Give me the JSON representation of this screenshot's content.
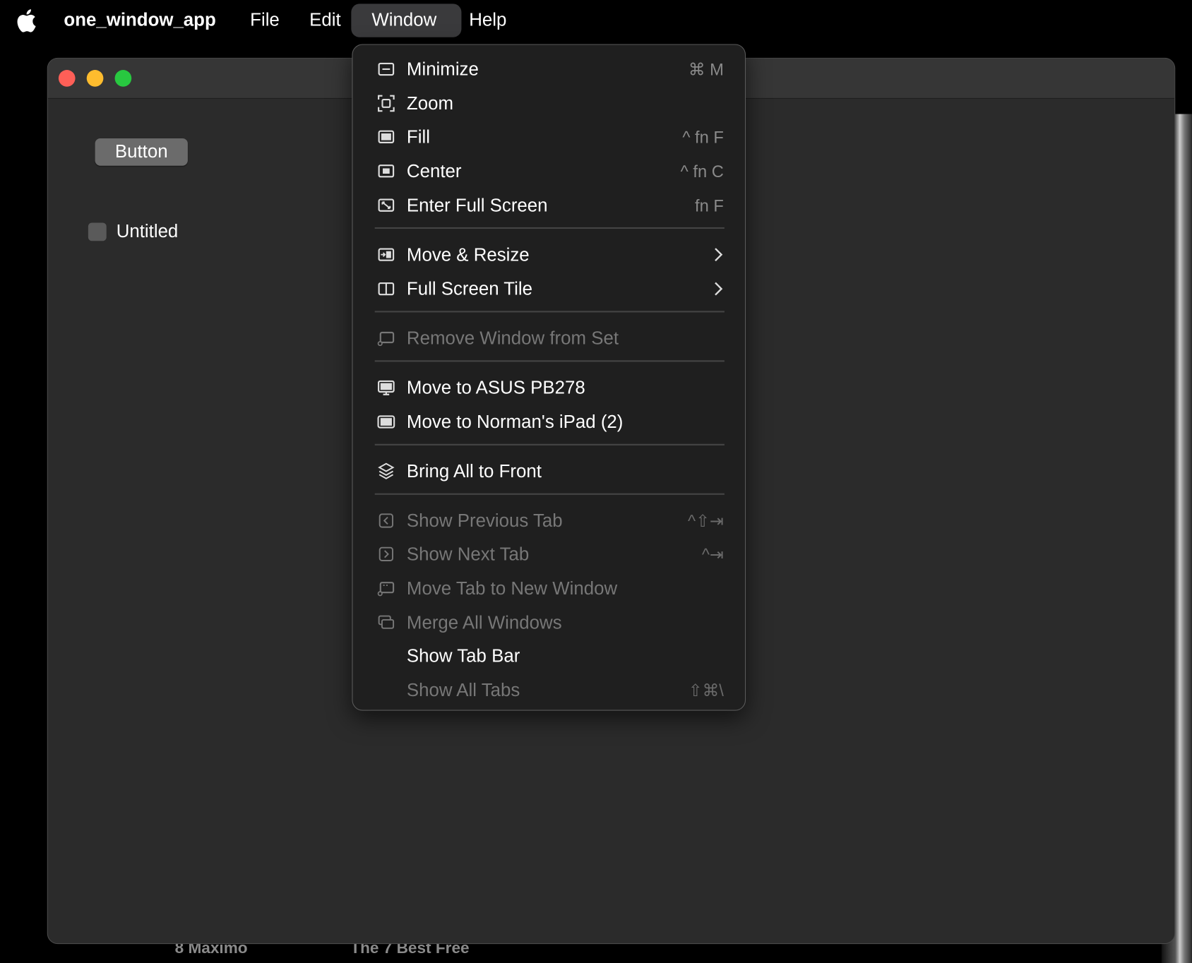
{
  "menubar": {
    "app_name": "one_window_app",
    "file": "File",
    "edit": "Edit",
    "window": "Window",
    "help": "Help"
  },
  "window_content": {
    "button_label": "Button",
    "checkbox_label": "Untitled"
  },
  "desktop": {
    "text_1": "8 Maximo",
    "text_2": "The 7 Best Free"
  },
  "window_menu": {
    "minimize": {
      "label": "Minimize",
      "shortcut": "⌘ M"
    },
    "zoom": {
      "label": "Zoom"
    },
    "fill": {
      "label": "Fill",
      "shortcut": "^ fn F"
    },
    "center": {
      "label": "Center",
      "shortcut": "^ fn C"
    },
    "enter_full_screen": {
      "label": "Enter Full Screen",
      "shortcut": "fn F"
    },
    "move_resize": {
      "label": "Move & Resize"
    },
    "full_screen_tile": {
      "label": "Full Screen Tile"
    },
    "remove_window_from_set": {
      "label": "Remove Window from Set"
    },
    "move_to_asus": {
      "label": "Move to ASUS PB278"
    },
    "move_to_ipad": {
      "label": "Move to Norman's iPad (2)"
    },
    "bring_all_to_front": {
      "label": "Bring All to Front"
    },
    "show_previous_tab": {
      "label": "Show Previous Tab",
      "shortcut": "^⇧⇥"
    },
    "show_next_tab": {
      "label": "Show Next Tab",
      "shortcut": "^⇥"
    },
    "move_tab_to_new_window": {
      "label": "Move Tab to New Window"
    },
    "merge_all_windows": {
      "label": "Merge All Windows"
    },
    "show_tab_bar": {
      "label": "Show Tab Bar"
    },
    "show_all_tabs": {
      "label": "Show All Tabs",
      "shortcut": "⇧⌘\\"
    }
  }
}
